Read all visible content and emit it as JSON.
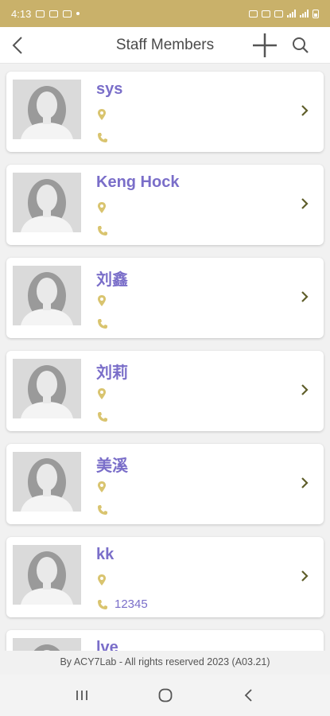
{
  "status_bar": {
    "time": "4:13"
  },
  "header": {
    "title": "Staff Members",
    "back_icon": "chevron-left-icon",
    "add_icon": "plus-icon",
    "search_icon": "search-icon"
  },
  "colors": {
    "accent_gold": "#c9b16a",
    "name_purple": "#7a6ec9",
    "chevron_olive": "#6b6a2a"
  },
  "staff": [
    {
      "name": "sys",
      "location": "",
      "phone": ""
    },
    {
      "name": "Keng Hock",
      "location": "",
      "phone": ""
    },
    {
      "name": "刘鑫",
      "location": "",
      "phone": ""
    },
    {
      "name": "刘莉",
      "location": "",
      "phone": ""
    },
    {
      "name": "美溪",
      "location": "",
      "phone": ""
    },
    {
      "name": "kk",
      "location": "",
      "phone": "12345"
    },
    {
      "name": "lve",
      "location": "",
      "phone": ""
    }
  ],
  "footer": {
    "text": "By ACY7Lab - All rights reserved 2023 (A03.21)"
  },
  "nav_bar": {
    "recents_icon": "recents-icon",
    "home_icon": "home-icon",
    "back_icon": "back-icon"
  }
}
